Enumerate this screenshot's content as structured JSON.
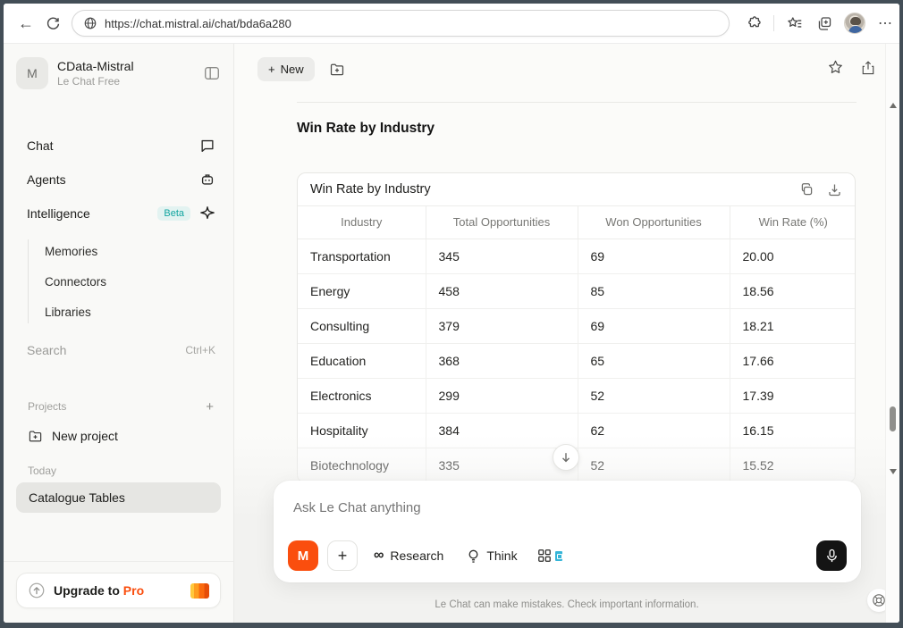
{
  "browser": {
    "url": "https://chat.mistral.ai/chat/bda6a280"
  },
  "icons": {
    "back": "←",
    "more": "⋯",
    "plus": "+",
    "infinity": "∞"
  },
  "sidebar": {
    "workspace": {
      "initial": "M",
      "name": "CData-Mistral",
      "plan": "Le Chat Free"
    },
    "nav": [
      {
        "label": "Chat"
      },
      {
        "label": "Agents"
      },
      {
        "label": "Intelligence",
        "badge": "Beta"
      }
    ],
    "subnav": [
      {
        "label": "Memories"
      },
      {
        "label": "Connectors"
      },
      {
        "label": "Libraries"
      }
    ],
    "search": {
      "label": "Search",
      "shortcut": "Ctrl+K"
    },
    "projects_label": "Projects",
    "new_project_label": "New project",
    "today_label": "Today",
    "history": [
      {
        "label": "Catalogue Tables",
        "selected": true
      }
    ],
    "upgrade": {
      "prefix": "Upgrade to",
      "plan": "Pro"
    }
  },
  "main": {
    "new_button_label": "New",
    "heading": "Win Rate by Industry",
    "table": {
      "title": "Win Rate by Industry",
      "columns": [
        "Industry",
        "Total Opportunities",
        "Won Opportunities",
        "Win Rate (%)"
      ],
      "rows": [
        [
          "Transportation",
          "345",
          "69",
          "20.00"
        ],
        [
          "Energy",
          "458",
          "85",
          "18.56"
        ],
        [
          "Consulting",
          "379",
          "69",
          "18.21"
        ],
        [
          "Education",
          "368",
          "65",
          "17.66"
        ],
        [
          "Electronics",
          "299",
          "52",
          "17.39"
        ],
        [
          "Hospitality",
          "384",
          "62",
          "16.15"
        ],
        [
          "Biotechnology",
          "335",
          "52",
          "15.52"
        ]
      ]
    }
  },
  "composer": {
    "placeholder": "Ask Le Chat anything",
    "logo_letter": "M",
    "research_label": "Research",
    "think_label": "Think"
  },
  "disclaimer": "Le Chat can make mistakes. Check important information.",
  "colors": {
    "accent_orange": "#fa4e0e",
    "beta_teal": "#12a5a0",
    "window_border": "#434e57"
  }
}
